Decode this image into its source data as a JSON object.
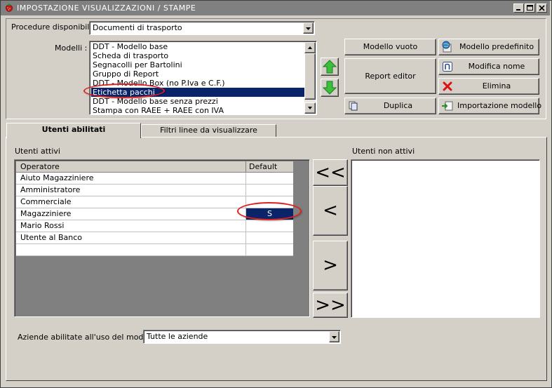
{
  "window": {
    "title": "IMPOSTAZIONE VISUALIZZAZIONI / STAMPE"
  },
  "procedure": {
    "label": "Procedure disponibili :",
    "value": "Documenti di trasporto"
  },
  "modelli": {
    "label": "Modelli :",
    "items": [
      "DDT - Modello base",
      "Scheda di trasporto",
      "Segnacolli per Bartolini",
      "Gruppo di Report",
      "DDT - Modello Box (no P.Iva e C.F.)",
      "Etichetta pacchi",
      "DDT - Modello base senza prezzi",
      "Stampa con RAEE + RAEE con IVA"
    ],
    "selected_index": 5
  },
  "buttons": {
    "modello_vuoto": "Modello vuoto",
    "modello_predefinito": "Modello predefinito",
    "report_editor": "Report editor",
    "modifica_nome": "Modifica nome",
    "elimina": "Elimina",
    "duplica": "Duplica",
    "importazione_modello": "Importazione modello"
  },
  "tabs": [
    {
      "label": "Utenti abilitati",
      "active": true
    },
    {
      "label": "Filtri linee da visualizzare",
      "active": false
    }
  ],
  "utenti_attivi": {
    "label": "Utenti attivi",
    "columns": [
      "Operatore",
      "Default"
    ],
    "rows": [
      {
        "operatore": "Aiuto Magazziniere",
        "default": ""
      },
      {
        "operatore": "Amministratore",
        "default": ""
      },
      {
        "operatore": "Commerciale",
        "default": ""
      },
      {
        "operatore": "Magazziniere",
        "default": "S"
      },
      {
        "operatore": "Mario Rossi",
        "default": ""
      },
      {
        "operatore": "Utente al Banco",
        "default": ""
      }
    ]
  },
  "move_buttons": {
    "all_left": "<<",
    "left": "<",
    "right": ">",
    "all_right": ">>"
  },
  "utenti_non_attivi": {
    "label": "Utenti non attivi"
  },
  "aziende": {
    "label": "Aziende abilitate all'uso del modello :",
    "value": "Tutte le aziende"
  },
  "colors": {
    "selection": "#0a246a",
    "highlight_circle": "#dd2222",
    "titlebar": "#808080",
    "arrow_green": "#2fa52f"
  },
  "icons": {
    "app": "strawberry-icon",
    "move_up": "green-arrow-up-icon",
    "move_down": "green-arrow-down-icon",
    "modello_predefinito": "globe-document-icon",
    "modifica_nome": "rename-n-icon",
    "elimina": "red-x-icon",
    "duplica": "duplicate-pages-icon",
    "importazione": "import-icon"
  }
}
